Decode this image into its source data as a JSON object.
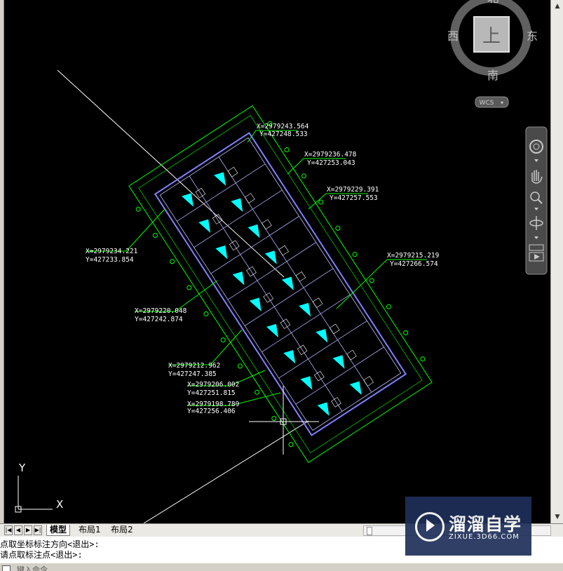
{
  "app": {
    "colors": {
      "viewport_bg": "#000000",
      "building_outline": "#8080ff",
      "dimension_lines": "#00ff00",
      "leader_lines": "#00ff00",
      "hatch": "#00ffff",
      "coord_text": "#ffffff",
      "crosshair": "#ffffff"
    }
  },
  "viewcube": {
    "north": "北",
    "south": "南",
    "west": "西",
    "east": "东",
    "face": "上",
    "wcs_label": "WCS"
  },
  "coordinates": [
    {
      "x": "X=2979243.564",
      "y": "Y=427248.533"
    },
    {
      "x": "X=2979236.478",
      "y": "Y=427253.043"
    },
    {
      "x": "X=2979229.391",
      "y": "Y=427257.553"
    },
    {
      "x": "X=2979215.219",
      "y": "Y=427266.574"
    },
    {
      "x": "X=2979234.221",
      "y": "Y=427233.854"
    },
    {
      "x": "X=2979220.048",
      "y": "Y=427242.874"
    },
    {
      "x": "X=2979212.962",
      "y": "Y=427247.385"
    },
    {
      "x": "X=2979206.002",
      "y": "Y=427251.815"
    },
    {
      "x": "X=2979198.789",
      "y": "Y=427256.406"
    }
  ],
  "ucs": {
    "x_label": "X",
    "y_label": "Y"
  },
  "navbar": {
    "icons": [
      "steering-wheel-icon",
      "pan-hand-icon",
      "zoom-icon",
      "orbit-icon",
      "showmotion-icon"
    ]
  },
  "tabs": {
    "nav_first": "|◀",
    "nav_prev": "◀",
    "nav_next": "▶",
    "nav_last": "▶|",
    "items": [
      "模型",
      "布局1",
      "布局2"
    ]
  },
  "command": {
    "line1": "点取坐标标注方向<退出>:",
    "line2": "请点取标注点<退出>:",
    "input_placeholder": "键入命令"
  },
  "watermark": {
    "brand": "溜溜自学",
    "url": "ZIXUE.3D66.COM"
  }
}
